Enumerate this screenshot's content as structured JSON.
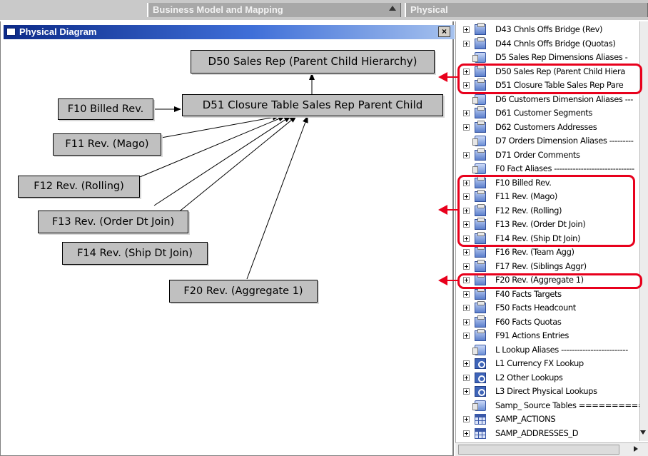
{
  "tabs": [
    {
      "label": "Business Model and Mapping"
    },
    {
      "label": "Physical"
    }
  ],
  "diagram": {
    "title": "Physical Diagram",
    "close_glyph": "×",
    "nodes": {
      "d50": "D50 Sales Rep (Parent Child Hierarchy)",
      "d51": "D51 Closure Table Sales Rep Parent Child",
      "f10": "F10 Billed Rev.",
      "f11": "F11 Rev. (Mago)",
      "f12": "F12 Rev. (Rolling)",
      "f13": "F13 Rev. (Order Dt Join)",
      "f14": "F14 Rev. (Ship Dt Join)",
      "f20": "F20 Rev. (Aggregate 1)"
    }
  },
  "tree": {
    "items": [
      {
        "label": "D43 Chnls Offs Bridge (Rev)",
        "icon": "table-folder-icon",
        "expandable": true
      },
      {
        "label": "D44 Chnls Offs Bridge (Quotas)",
        "icon": "table-folder-icon",
        "expandable": true
      },
      {
        "label": "D5 Sales Rep Dimensions Aliases -",
        "icon": "alias-icon",
        "expandable": false
      },
      {
        "label": "D50 Sales Rep (Parent Child Hiera",
        "icon": "table-folder-icon",
        "expandable": true
      },
      {
        "label": "D51 Closure Table Sales Rep Pare",
        "icon": "table-folder-icon",
        "expandable": true
      },
      {
        "label": "D6 Customers Dimension Aliases ---",
        "icon": "alias-icon",
        "expandable": false
      },
      {
        "label": "D61 Customer Segments",
        "icon": "table-folder-icon",
        "expandable": true
      },
      {
        "label": "D62 Customers Addresses",
        "icon": "table-folder-icon",
        "expandable": true
      },
      {
        "label": "D7 Orders Dimension Aliases ---------",
        "icon": "alias-icon",
        "expandable": false
      },
      {
        "label": "D71 Order Comments",
        "icon": "table-folder-icon",
        "expandable": true
      },
      {
        "label": "F0 Fact Aliases ------------------------------",
        "icon": "alias-icon",
        "expandable": false
      },
      {
        "label": "F10 Billed Rev.",
        "icon": "table-folder-icon",
        "expandable": true
      },
      {
        "label": "F11 Rev. (Mago)",
        "icon": "table-folder-icon",
        "expandable": true
      },
      {
        "label": "F12 Rev. (Rolling)",
        "icon": "table-folder-icon",
        "expandable": true
      },
      {
        "label": "F13 Rev. (Order Dt Join)",
        "icon": "table-folder-icon",
        "expandable": true
      },
      {
        "label": "F14 Rev. (Ship Dt Join)",
        "icon": "table-folder-icon",
        "expandable": true
      },
      {
        "label": "F16 Rev. (Team Agg)",
        "icon": "table-folder-icon",
        "expandable": true
      },
      {
        "label": "F17 Rev. (Siblings Aggr)",
        "icon": "table-folder-icon",
        "expandable": true
      },
      {
        "label": "F20 Rev. (Aggregate 1)",
        "icon": "table-folder-icon",
        "expandable": true
      },
      {
        "label": "F40 Facts Targets",
        "icon": "table-folder-icon",
        "expandable": true
      },
      {
        "label": "F50 Facts Headcount",
        "icon": "table-folder-icon",
        "expandable": true
      },
      {
        "label": "F60 Facts Quotas",
        "icon": "table-folder-icon",
        "expandable": true
      },
      {
        "label": "F91 Actions Entries",
        "icon": "table-folder-icon",
        "expandable": true
      },
      {
        "label": "L Lookup Aliases -------------------------",
        "icon": "alias-icon",
        "expandable": false
      },
      {
        "label": "L1 Currency FX Lookup",
        "icon": "lookup-icon",
        "expandable": true
      },
      {
        "label": "L2 Other Lookups",
        "icon": "lookup-icon",
        "expandable": true
      },
      {
        "label": "L3 Direct Physical Lookups",
        "icon": "lookup-icon",
        "expandable": true
      },
      {
        "label": "Samp_ Source Tables ==========",
        "icon": "alias-icon",
        "expandable": false
      },
      {
        "label": "SAMP_ACTIONS",
        "icon": "table-icon",
        "expandable": true
      },
      {
        "label": "SAMP_ADDRESSES_D",
        "icon": "table-icon",
        "expandable": true
      }
    ]
  },
  "colors": {
    "highlight": "#e8001c",
    "node_fill": "#c0c0c0",
    "titlebar": "#0c2a88"
  }
}
